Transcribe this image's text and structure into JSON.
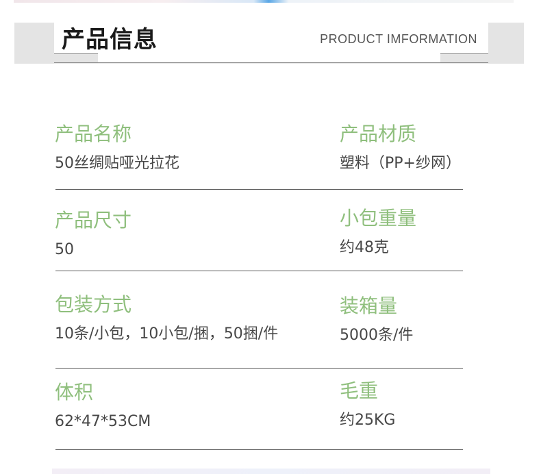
{
  "header": {
    "title_cn": "产品信息",
    "title_en": "PRODUCT IMFORMATION"
  },
  "specs": [
    {
      "label": "产品名称",
      "value": "50丝绸贴哑光拉花"
    },
    {
      "label": "产品材质",
      "value": "塑料（PP+纱网）"
    },
    {
      "label": "产品尺寸",
      "value": "50"
    },
    {
      "label": "小包重量",
      "value": "约48克"
    },
    {
      "label": "包装方式",
      "value": "10条/小包，10小包/捆，50捆/件"
    },
    {
      "label": "装箱量",
      "value": "5000条/件"
    },
    {
      "label": "体积",
      "value": "62*47*53CM"
    },
    {
      "label": "毛重",
      "value": "约25KG"
    }
  ],
  "colors": {
    "label": "#8fbf7d",
    "value": "#474747",
    "header_bg": "#e4e4e4"
  }
}
